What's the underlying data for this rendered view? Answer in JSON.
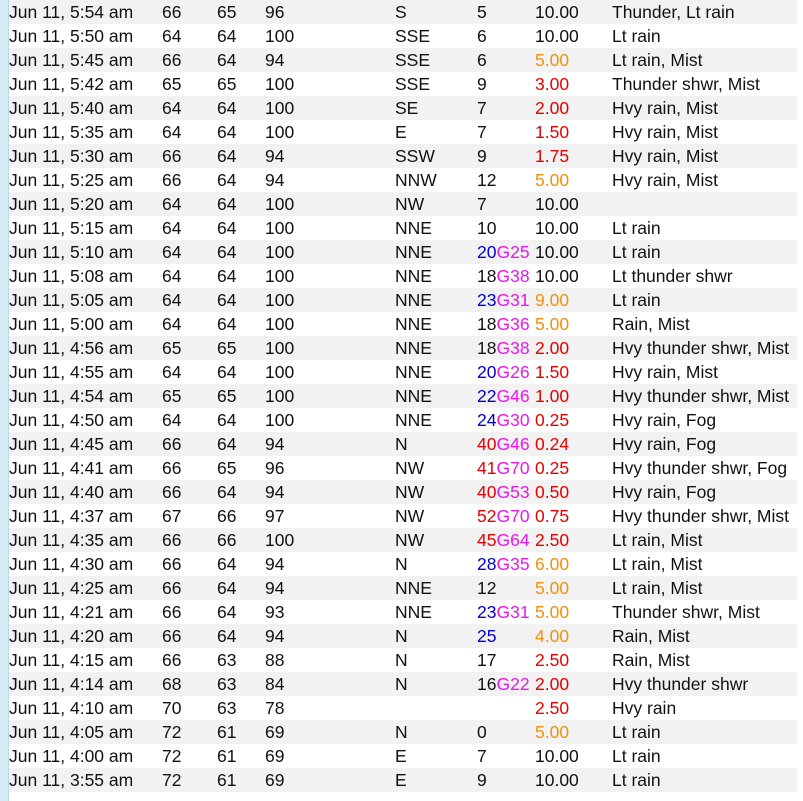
{
  "colors": {
    "blue": "#0000cc",
    "magenta": "#e619e6",
    "red": "#e60000",
    "orange": "#f0900a",
    "edge_marker": "#f5a623"
  },
  "rows": [
    {
      "time": "Jun 11, 5:54 am",
      "temp": "66",
      "dew": "65",
      "hum": "96",
      "dir": "S",
      "wind": "5",
      "gust": "",
      "vis": "10.00",
      "weather": "Thunder, Lt rain"
    },
    {
      "time": "Jun 11, 5:50 am",
      "temp": "64",
      "dew": "64",
      "hum": "100",
      "dir": "SSE",
      "wind": "6",
      "gust": "",
      "vis": "10.00",
      "weather": "Lt rain"
    },
    {
      "time": "Jun 11, 5:45 am",
      "temp": "66",
      "dew": "64",
      "hum": "94",
      "dir": "SSE",
      "wind": "6",
      "gust": "",
      "vis": "5.00",
      "weather": "Lt rain, Mist"
    },
    {
      "time": "Jun 11, 5:42 am",
      "temp": "65",
      "dew": "65",
      "hum": "100",
      "dir": "SSE",
      "wind": "9",
      "gust": "",
      "vis": "3.00",
      "weather": "Thunder shwr, Mist"
    },
    {
      "time": "Jun 11, 5:40 am",
      "temp": "64",
      "dew": "64",
      "hum": "100",
      "dir": "SE",
      "wind": "7",
      "gust": "",
      "vis": "2.00",
      "weather": "Hvy rain, Mist"
    },
    {
      "time": "Jun 11, 5:35 am",
      "temp": "64",
      "dew": "64",
      "hum": "100",
      "dir": "E",
      "wind": "7",
      "gust": "",
      "vis": "1.50",
      "weather": "Hvy rain, Mist"
    },
    {
      "time": "Jun 11, 5:30 am",
      "temp": "66",
      "dew": "64",
      "hum": "94",
      "dir": "SSW",
      "wind": "9",
      "gust": "",
      "vis": "1.75",
      "weather": "Hvy rain, Mist"
    },
    {
      "time": "Jun 11, 5:25 am",
      "temp": "66",
      "dew": "64",
      "hum": "94",
      "dir": "NNW",
      "wind": "12",
      "gust": "",
      "vis": "5.00",
      "weather": "Hvy rain, Mist"
    },
    {
      "time": "Jun 11, 5:20 am",
      "temp": "64",
      "dew": "64",
      "hum": "100",
      "dir": "NW",
      "wind": "7",
      "gust": "",
      "vis": "10.00",
      "weather": ""
    },
    {
      "time": "Jun 11, 5:15 am",
      "temp": "64",
      "dew": "64",
      "hum": "100",
      "dir": "NNE",
      "wind": "10",
      "gust": "",
      "vis": "10.00",
      "weather": "Lt rain"
    },
    {
      "time": "Jun 11, 5:10 am",
      "temp": "64",
      "dew": "64",
      "hum": "100",
      "dir": "NNE",
      "wind": "20",
      "gust": "G25",
      "vis": "10.00",
      "weather": "Lt rain"
    },
    {
      "time": "Jun 11, 5:08 am",
      "temp": "64",
      "dew": "64",
      "hum": "100",
      "dir": "NNE",
      "wind": "18",
      "gust": "G38",
      "vis": "10.00",
      "weather": "Lt thunder shwr"
    },
    {
      "time": "Jun 11, 5:05 am",
      "temp": "64",
      "dew": "64",
      "hum": "100",
      "dir": "NNE",
      "wind": "23",
      "gust": "G31",
      "vis": "9.00",
      "weather": "Lt rain"
    },
    {
      "time": "Jun 11, 5:00 am",
      "temp": "64",
      "dew": "64",
      "hum": "100",
      "dir": "NNE",
      "wind": "18",
      "gust": "G36",
      "vis": "5.00",
      "weather": "Rain, Mist"
    },
    {
      "time": "Jun 11, 4:56 am",
      "temp": "65",
      "dew": "65",
      "hum": "100",
      "dir": "NNE",
      "wind": "18",
      "gust": "G38",
      "vis": "2.00",
      "weather": "Hvy thunder shwr, Mist"
    },
    {
      "time": "Jun 11, 4:55 am",
      "temp": "64",
      "dew": "64",
      "hum": "100",
      "dir": "NNE",
      "wind": "20",
      "gust": "G26",
      "vis": "1.50",
      "weather": "Hvy rain, Mist"
    },
    {
      "time": "Jun 11, 4:54 am",
      "temp": "65",
      "dew": "65",
      "hum": "100",
      "dir": "NNE",
      "wind": "22",
      "gust": "G46",
      "vis": "1.00",
      "weather": "Hvy thunder shwr, Mist"
    },
    {
      "time": "Jun 11, 4:50 am",
      "temp": "64",
      "dew": "64",
      "hum": "100",
      "dir": "NNE",
      "wind": "24",
      "gust": "G30",
      "vis": "0.25",
      "weather": "Hvy rain, Fog"
    },
    {
      "time": "Jun 11, 4:45 am",
      "temp": "66",
      "dew": "64",
      "hum": "94",
      "dir": "N",
      "wind": "40",
      "gust": "G46",
      "vis": "0.24",
      "weather": "Hvy rain, Fog"
    },
    {
      "time": "Jun 11, 4:41 am",
      "temp": "66",
      "dew": "65",
      "hum": "96",
      "dir": "NW",
      "wind": "41",
      "gust": "G70",
      "vis": "0.25",
      "weather": "Hvy thunder shwr, Fog"
    },
    {
      "time": "Jun 11, 4:40 am",
      "temp": "66",
      "dew": "64",
      "hum": "94",
      "dir": "NW",
      "wind": "40",
      "gust": "G53",
      "vis": "0.50",
      "weather": "Hvy rain, Fog"
    },
    {
      "time": "Jun 11, 4:37 am",
      "temp": "67",
      "dew": "66",
      "hum": "97",
      "dir": "NW",
      "wind": "52",
      "gust": "G70",
      "vis": "0.75",
      "weather": "Hvy thunder shwr, Mist"
    },
    {
      "time": "Jun 11, 4:35 am",
      "temp": "66",
      "dew": "66",
      "hum": "100",
      "dir": "NW",
      "wind": "45",
      "gust": "G64",
      "vis": "2.50",
      "weather": "Lt rain, Mist"
    },
    {
      "time": "Jun 11, 4:30 am",
      "temp": "66",
      "dew": "64",
      "hum": "94",
      "dir": "N",
      "wind": "28",
      "gust": "G35",
      "vis": "6.00",
      "weather": "Lt rain, Mist"
    },
    {
      "time": "Jun 11, 4:25 am",
      "temp": "66",
      "dew": "64",
      "hum": "94",
      "dir": "NNE",
      "wind": "12",
      "gust": "",
      "vis": "5.00",
      "weather": "Lt rain, Mist"
    },
    {
      "time": "Jun 11, 4:21 am",
      "temp": "66",
      "dew": "64",
      "hum": "93",
      "dir": "NNE",
      "wind": "23",
      "gust": "G31",
      "vis": "5.00",
      "weather": "Thunder shwr, Mist"
    },
    {
      "time": "Jun 11, 4:20 am",
      "temp": "66",
      "dew": "64",
      "hum": "94",
      "dir": "N",
      "wind": "25",
      "gust": "",
      "vis": "4.00",
      "weather": "Rain, Mist"
    },
    {
      "time": "Jun 11, 4:15 am",
      "temp": "66",
      "dew": "63",
      "hum": "88",
      "dir": "N",
      "wind": "17",
      "gust": "",
      "vis": "2.50",
      "weather": "Rain, Mist"
    },
    {
      "time": "Jun 11, 4:14 am",
      "temp": "68",
      "dew": "63",
      "hum": "84",
      "dir": "N",
      "wind": "16",
      "gust": "G22",
      "vis": "2.00",
      "weather": "Hvy thunder shwr"
    },
    {
      "time": "Jun 11, 4:10 am",
      "temp": "70",
      "dew": "63",
      "hum": "78",
      "dir": "",
      "wind": "",
      "gust": "",
      "vis": "2.50",
      "weather": "Hvy rain"
    },
    {
      "time": "Jun 11, 4:05 am",
      "temp": "72",
      "dew": "61",
      "hum": "69",
      "dir": "N",
      "wind": "0",
      "gust": "",
      "vis": "5.00",
      "weather": "Lt rain"
    },
    {
      "time": "Jun 11, 4:00 am",
      "temp": "72",
      "dew": "61",
      "hum": "69",
      "dir": "E",
      "wind": "7",
      "gust": "",
      "vis": "10.00",
      "weather": "Lt rain"
    },
    {
      "time": "Jun 11, 3:55 am",
      "temp": "72",
      "dew": "61",
      "hum": "69",
      "dir": "E",
      "wind": "9",
      "gust": "",
      "vis": "10.00",
      "weather": "Lt rain"
    }
  ]
}
